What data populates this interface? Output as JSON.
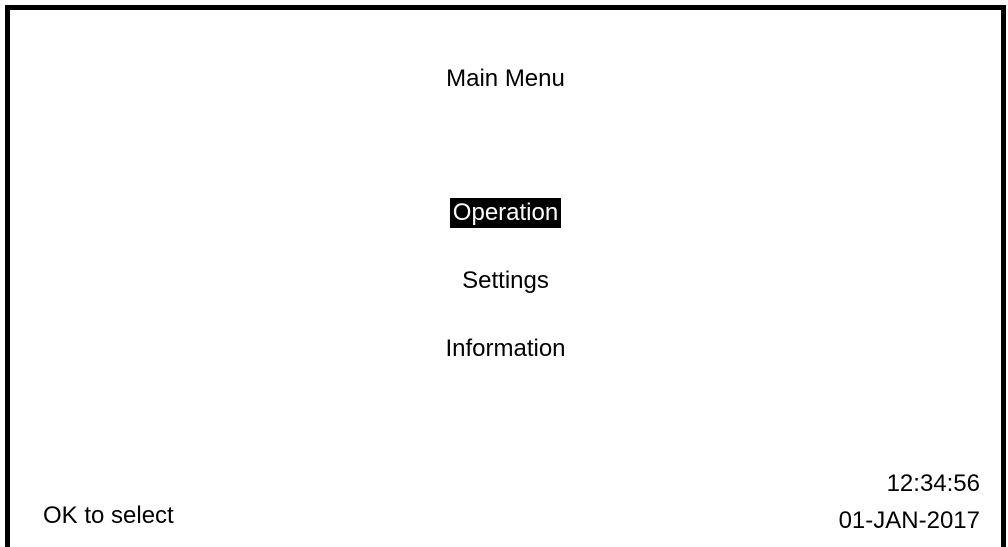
{
  "header": {
    "title": "Main Menu"
  },
  "menu": {
    "items": [
      {
        "label": "Operation",
        "selected": true
      },
      {
        "label": "Settings",
        "selected": false
      },
      {
        "label": "Information",
        "selected": false
      }
    ]
  },
  "footer": {
    "hint": "OK to select",
    "time": "12:34:56",
    "date": "01-JAN-2017"
  },
  "colors": {
    "background": "#ffffff",
    "foreground": "#000000",
    "highlight_bg": "#000000",
    "highlight_fg": "#ffffff"
  }
}
